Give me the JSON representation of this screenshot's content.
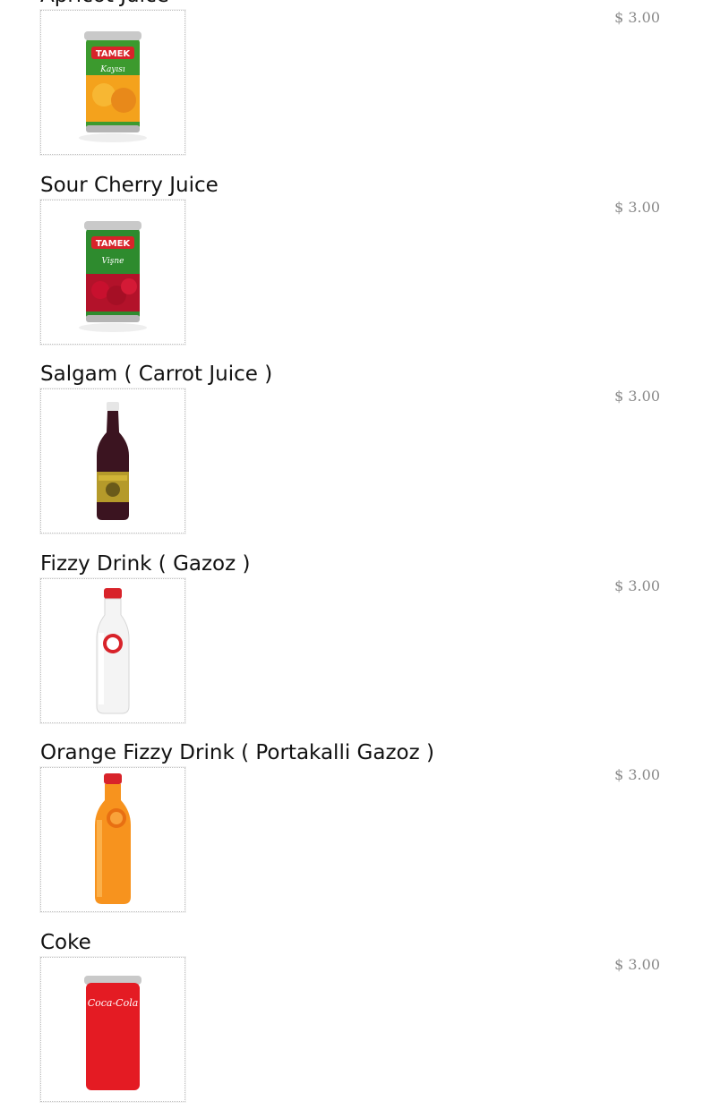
{
  "menu": {
    "items": [
      {
        "name": "Apricot Juice",
        "price": "$ 3.00",
        "image": "apricot-juice-can"
      },
      {
        "name": "Sour Cherry Juice",
        "price": "$ 3.00",
        "image": "sour-cherry-juice-can"
      },
      {
        "name": "Salgam ( Carrot Juice )",
        "price": "$ 3.00",
        "image": "salgam-bottle"
      },
      {
        "name": "Fizzy Drink ( Gazoz )",
        "price": "$ 3.00",
        "image": "clear-soda-bottle"
      },
      {
        "name": "Orange Fizzy Drink ( Portakalli Gazoz )",
        "price": "$ 3.00",
        "image": "orange-soda-bottle"
      },
      {
        "name": "Coke",
        "price": "$ 3.00",
        "image": "coke-can"
      }
    ],
    "can_brand": "TAMEK",
    "can_labels": [
      "Kayısı",
      "Vişne"
    ],
    "coke_logo": "Coca-Cola",
    "colors": {
      "title": "#111111",
      "price": "#8a8a8a",
      "thumb_border": "#bdbdbd",
      "tamek_red": "#d8232a",
      "apricot": "#f4a21c",
      "cherry": "#b3122a",
      "salgam": "#3b1420",
      "orange_soda": "#f7931e",
      "coke_red": "#e41b23"
    }
  }
}
